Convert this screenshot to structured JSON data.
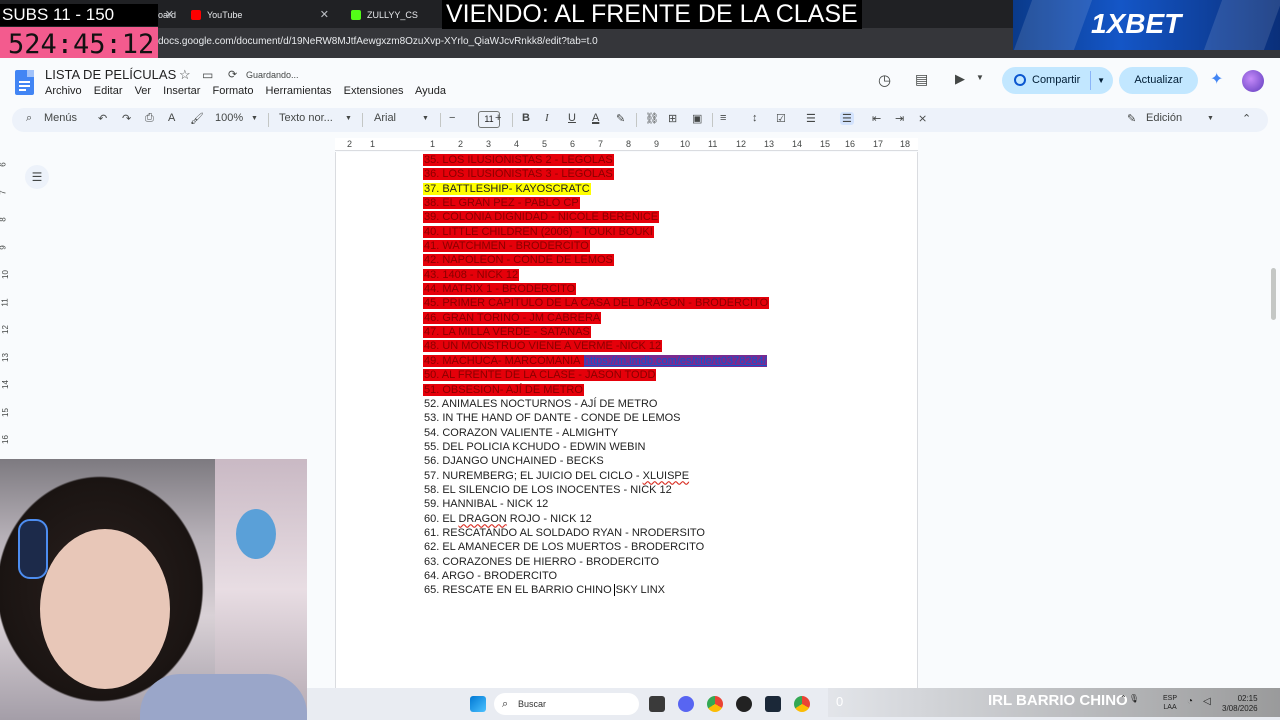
{
  "browser": {
    "tabs": [
      {
        "label": "Dashboard",
        "favicon_color": "#8ab4f8"
      },
      {
        "label": "YouTube",
        "favicon_color": "#ff0000"
      },
      {
        "label": "ZULLYY_CS Stream - W",
        "favicon_color": "#53fc18"
      }
    ],
    "url": "docs.google.com/document/d/19NeRW8MJtfAewgxzm8OzuXvp-XYrlo_QiaWJcvRnkk8/edit?tab=t.0"
  },
  "overlay": {
    "subs": "SUBS 11 - 150",
    "timer": "524:45:12",
    "viendo": "VIENDO: AL FRENTE DE LA CLASE",
    "ad_brand": "1XBET"
  },
  "docs": {
    "title": "LISTA DE PELÍCULAS",
    "saving": "Guardando...",
    "menu": [
      "Archivo",
      "Editar",
      "Ver",
      "Insertar",
      "Formato",
      "Herramientas",
      "Extensiones",
      "Ayuda"
    ],
    "share_label": "Compartir",
    "update_label": "Actualizar",
    "toolbar": {
      "menus": "Menús",
      "zoom": "100%",
      "style": "Texto nor...",
      "font": "Arial",
      "font_size": "11",
      "mode": "Edición"
    },
    "ruler_numbers": [
      "2",
      "1",
      "1",
      "2",
      "3",
      "4",
      "5",
      "6",
      "7",
      "8",
      "9",
      "10",
      "11",
      "12",
      "13",
      "14",
      "15",
      "16",
      "17",
      "18"
    ],
    "vruler_numbers": [
      "6",
      "7",
      "8",
      "9",
      "10",
      "11",
      "12",
      "13",
      "14",
      "15",
      "16"
    ],
    "items": [
      {
        "text": "35. LOS ILUSIONISTAS 2 - LEGOLAS",
        "hl": "red"
      },
      {
        "text": "36. LOS ILUSIONISTAS 3 - LEGOLAS",
        "hl": "red"
      },
      {
        "text": "37. BATTLESHIP- KAYOSCRATC",
        "hl": "yellow"
      },
      {
        "text": "38. EL GRAN PEZ - PABLO CP",
        "hl": "red"
      },
      {
        "text": "39. COLONIA DIGNIDAD - NICOLE BERENICE",
        "hl": "red"
      },
      {
        "text": "40. LITTLE CHILDREN (2006) - TOUKI BOUKI",
        "hl": "red"
      },
      {
        "text": "41. WATCHMEN - BRODERCITO",
        "hl": "red"
      },
      {
        "text": "42. NAPOLEON - CONDE DE LEMOS",
        "hl": "red"
      },
      {
        "text": "43. 1408 - NICK 12",
        "hl": "red"
      },
      {
        "text": "44. MATRIX 1 -  BRODERCITO",
        "hl": "red"
      },
      {
        "text": "45. PRIMER CAPITULO DE LA CASA DEL DRAGON - BRODERCITO",
        "hl": "red"
      },
      {
        "text": "46. GRAN TORINO - JM CABRERA",
        "hl": "red"
      },
      {
        "text": "47. LA MILLA VERDE - SATANAS",
        "hl": "red"
      },
      {
        "text": "48. UN MONSTRUO VIENE A VERME -NICK 12",
        "hl": "red"
      },
      {
        "text": "49. MACHUCA- MARCOMANIA ",
        "hl": "red",
        "link": "https://m.imdb.com/es/title/tt0378284/"
      },
      {
        "text": "50. AL FRENTE DE LA CLASE - JASON TODD",
        "hl": "red"
      },
      {
        "text": "51. OBSESION- AJÍ DE METRO",
        "hl": "red"
      },
      {
        "text": "52. ANIMALES NOCTURNOS - AJÍ DE METRO",
        "hl": "none"
      },
      {
        "text": "53. IN THE HAND OF DANTE - CONDE DE LEMOS",
        "hl": "none"
      },
      {
        "text": "54. CORAZON VALIENTE - ALMIGHTY",
        "hl": "none"
      },
      {
        "text": "55. DEL POLICIA KCHUDO -  EDWIN WEBIN",
        "hl": "none"
      },
      {
        "text": "56. DJANGO UNCHAINED - BECKS",
        "hl": "none"
      },
      {
        "text": "57. NUREMBERG; EL JUICIO DEL CICLO - XLUISPE",
        "hl": "none"
      },
      {
        "text": "58. EL SILENCIO DE LOS INOCENTES - NICK 12",
        "hl": "none"
      },
      {
        "text": "59. HANNIBAL - NICK 12",
        "hl": "none"
      },
      {
        "text": "60. EL DRAGON ROJO - NICK 12",
        "hl": "none"
      },
      {
        "text": "61. RESCATANDO AL SOLDADO RYAN - NRODERSITO",
        "hl": "none"
      },
      {
        "text": "62. EL AMANECER DE LOS MUERTOS - BRODERCITO",
        "hl": "none"
      },
      {
        "text": "63. CORAZONES DE HIERRO - BRODERCITO",
        "hl": "none"
      },
      {
        "text": "64. ARGO - BRODERCITO",
        "hl": "none"
      },
      {
        "text": "65. RESCATE EN EL BARRIO CHINO",
        "after_caret": "SKY LINX",
        "hl": "none"
      }
    ]
  },
  "taskbar": {
    "search_placeholder": "Buscar",
    "irl_count": "0",
    "irl_label": "IRL BARRIO CHINO",
    "lang_line1": "ESP",
    "lang_line2": "LAA",
    "time": "02:15",
    "date": "3/08/2026"
  }
}
